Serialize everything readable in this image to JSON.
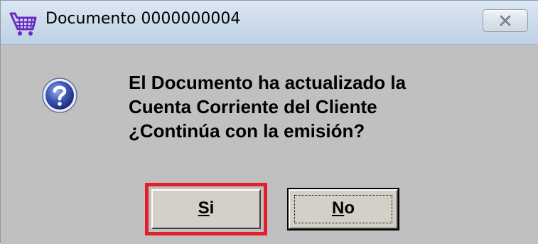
{
  "window": {
    "title": "Documento 0000000004",
    "app_icon": "shopping-cart-icon",
    "close_icon": "close-icon"
  },
  "dialog": {
    "icon": "question-icon",
    "message_lines": [
      "El Documento ha actualizado la",
      "Cuenta Corriente del Cliente",
      "¿Continúa con la emisión?"
    ]
  },
  "buttons": {
    "yes": {
      "mnemonic": "S",
      "rest": "i"
    },
    "no": {
      "mnemonic": "N",
      "rest": "o"
    }
  },
  "colors": {
    "highlight": "#e3202a",
    "dialog_background": "#c0c0c0",
    "button_face": "#d4d0c8",
    "app_icon": "#6a2bc2"
  }
}
